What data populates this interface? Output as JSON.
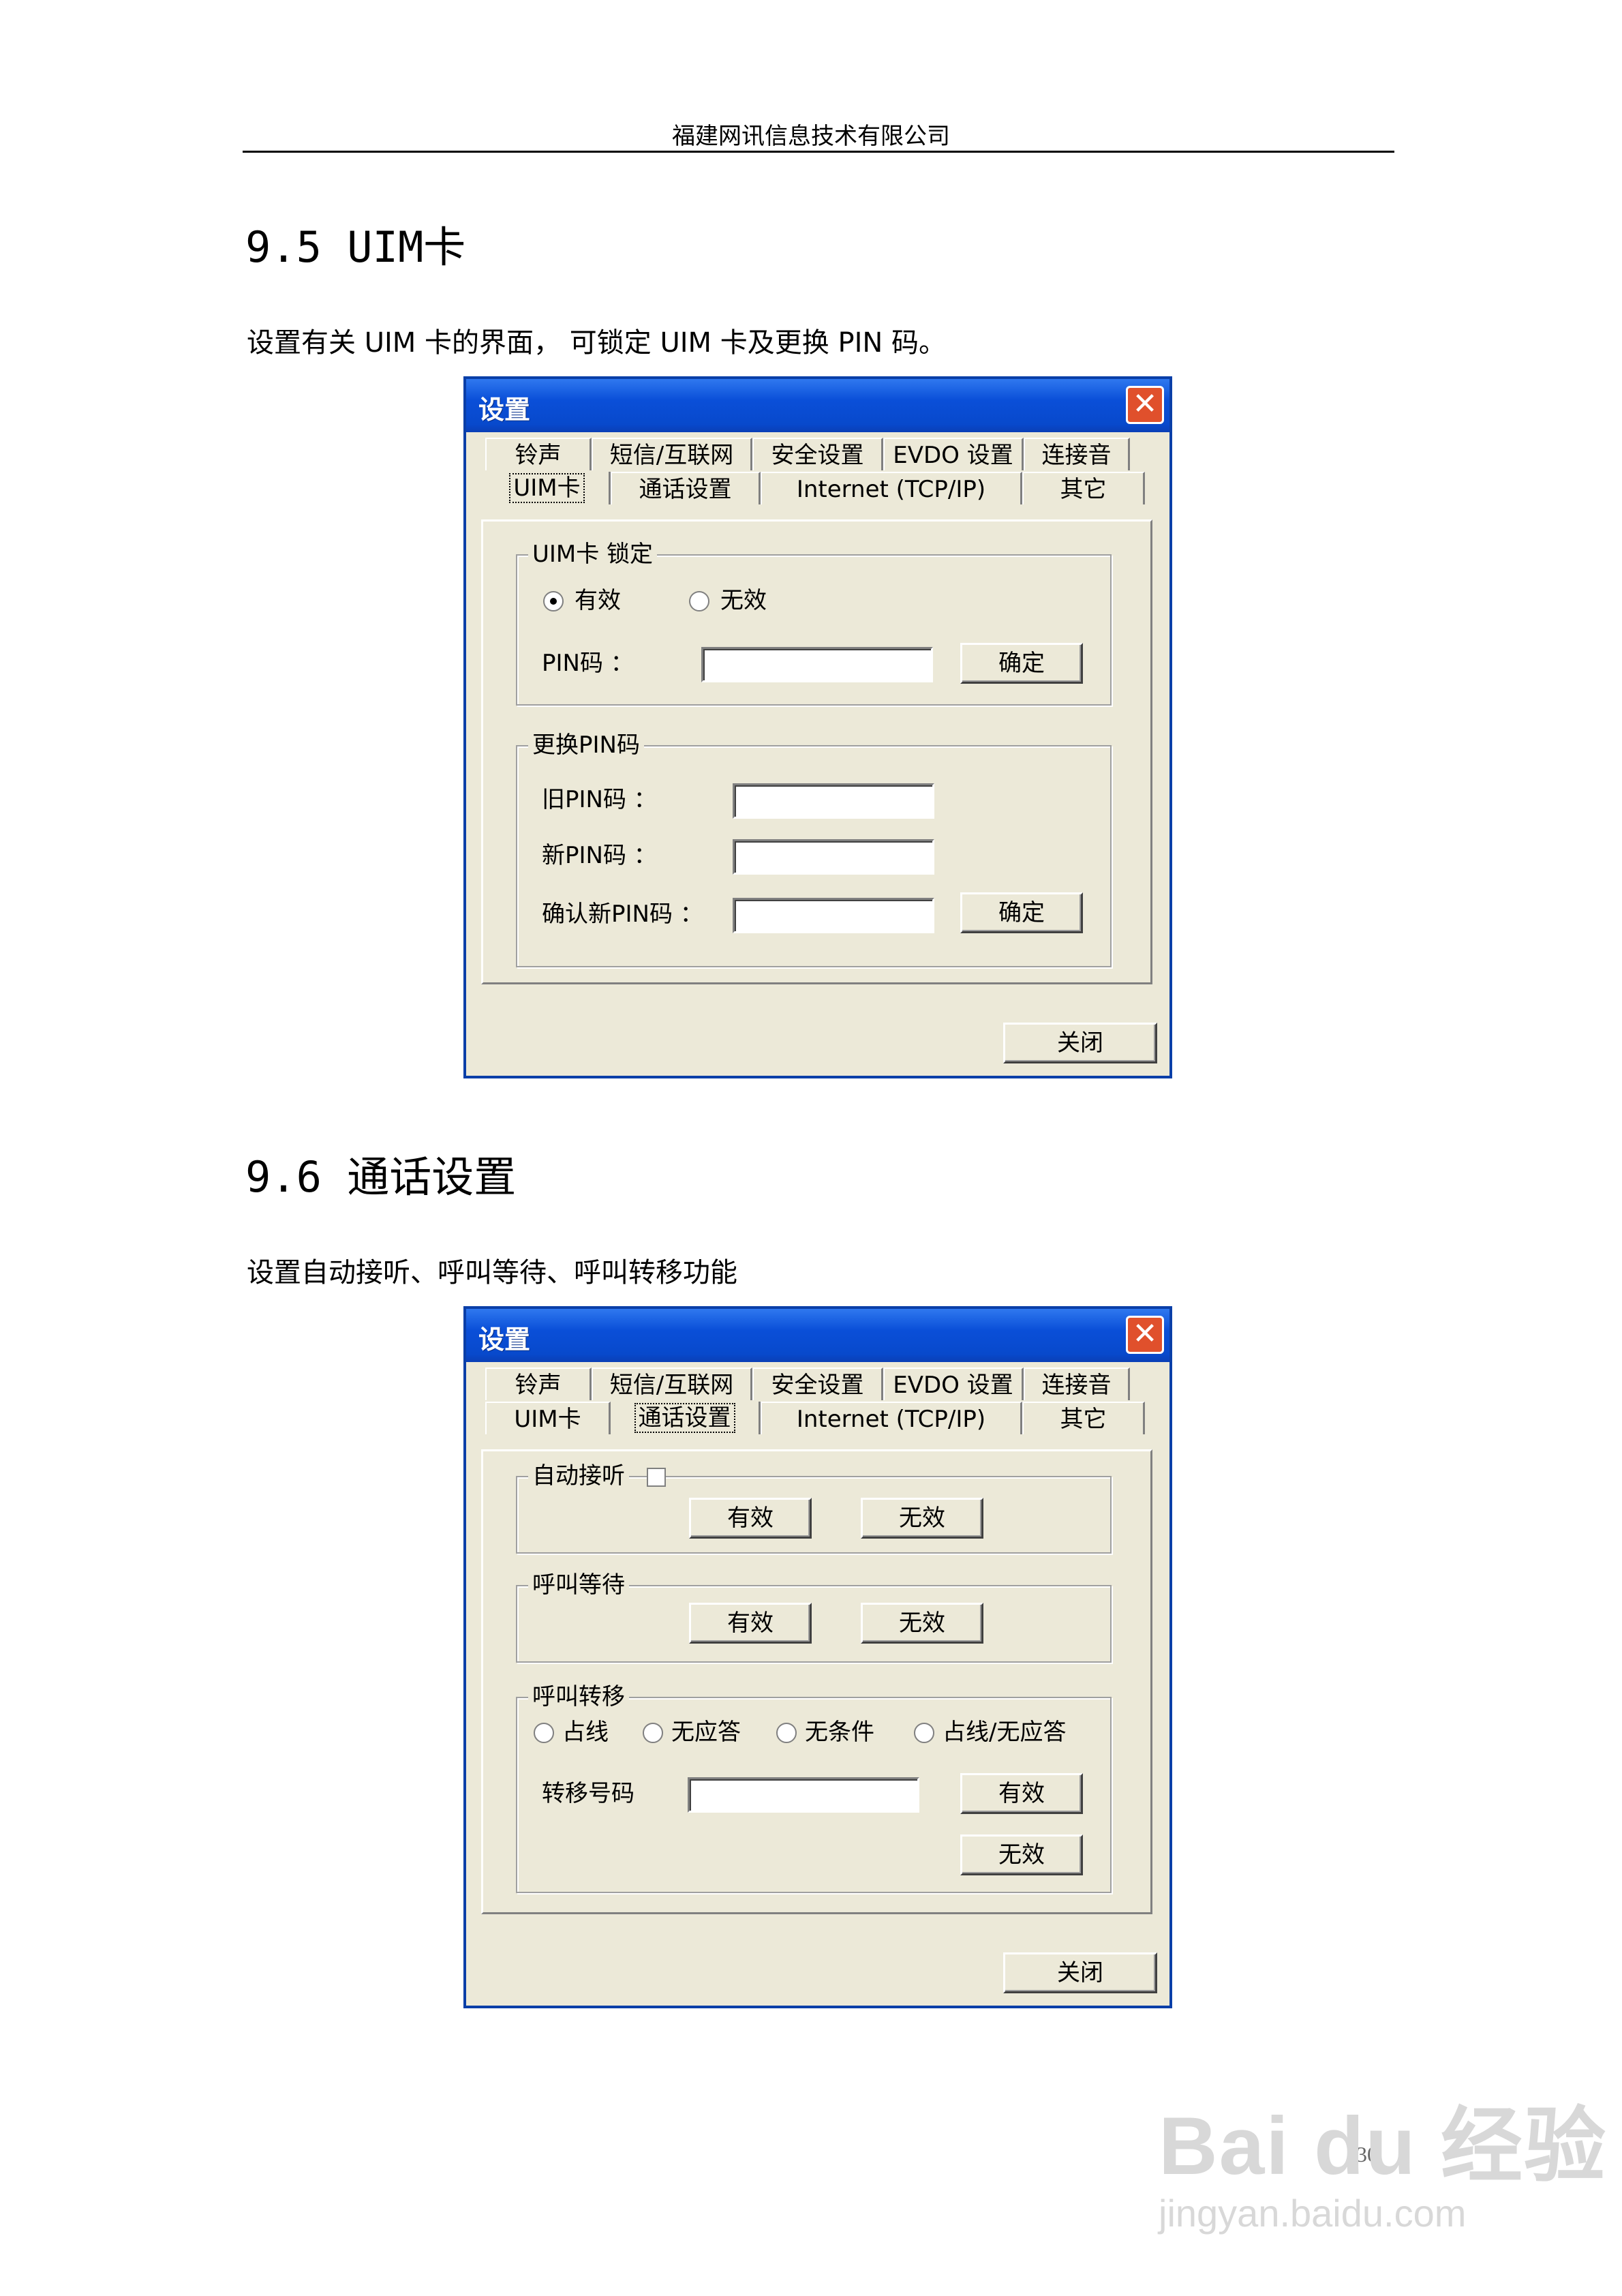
{
  "header": {
    "company": "福建网讯信息技术有限公司"
  },
  "section1": {
    "heading": "9.5 UIM卡",
    "description": "设置有关 UIM 卡的界面， 可锁定 UIM 卡及更换 PIN 码。",
    "window": {
      "title": "设置",
      "close_glyph": "✕",
      "tabs_row1": [
        "铃声",
        "短信/互联网",
        "安全设置",
        "EVDO 设置",
        "连接音"
      ],
      "tabs_row2": [
        "UIM卡",
        "通话设置",
        "Internet (TCP/IP)",
        "其它"
      ],
      "selected_tab": "UIM卡",
      "lock_group": {
        "label": "UIM卡 锁定",
        "radio_valid": "有效",
        "radio_invalid": "无效",
        "selected": "有效",
        "pin_label": "PIN码 ：",
        "pin_value": "",
        "confirm": "确定"
      },
      "change_group": {
        "label": "更换PIN码",
        "old_label": "旧PIN码 ：",
        "new_label": "新PIN码 ：",
        "confirm_label": "确认新PIN码 ：",
        "confirm": "确定"
      },
      "close_button": "关闭"
    }
  },
  "section2": {
    "heading": "9.6 通话设置",
    "description": "设置自动接听、呼叫等待、呼叫转移功能",
    "window": {
      "title": "设置",
      "close_glyph": "✕",
      "tabs_row1": [
        "铃声",
        "短信/互联网",
        "安全设置",
        "EVDO 设置",
        "连接音"
      ],
      "tabs_row2": [
        "UIM卡",
        "通话设置",
        "Internet (TCP/IP)",
        "其它"
      ],
      "selected_tab": "通话设置",
      "auto_answer": {
        "label": "自动接听",
        "checked": false,
        "enable": "有效",
        "disable": "无效"
      },
      "call_waiting": {
        "label": "呼叫等待",
        "enable": "有效",
        "disable": "无效"
      },
      "call_forward": {
        "label": "呼叫转移",
        "options": [
          "占线",
          "无应答",
          "无条件",
          "占线/无应答"
        ],
        "number_label": "转移号码",
        "number_value": "",
        "enable": "有效",
        "disable": "无效"
      },
      "close_button": "关闭"
    }
  },
  "page_number": "30",
  "watermark": {
    "brand": "Bai du 经验",
    "url": "jingyan.baidu.com"
  }
}
